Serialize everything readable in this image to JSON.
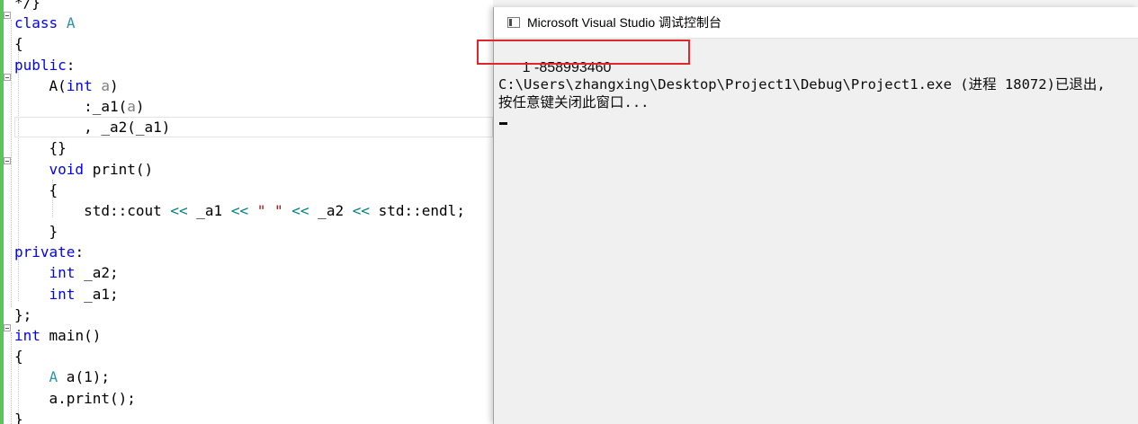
{
  "editor": {
    "lines": [
      "*/}",
      "class A",
      "{",
      "public:",
      "    A(int a)",
      "        :_a1(a)",
      "        , _a2(_a1)",
      "    {}",
      "    void print()",
      "    {",
      "        std::cout << _a1 << \" \" << _a2 << std::endl;",
      "    }",
      "private:",
      "    int _a2;",
      "    int _a1;",
      "};",
      "int main()",
      "{",
      "    A a(1);",
      "    a.print();",
      "}"
    ]
  },
  "console": {
    "title": "Microsoft Visual Studio 调试控制台",
    "output_line": "1 -858993460",
    "exit_line": "C:\\Users\\zhangxing\\Desktop\\Project1\\Debug\\Project1.exe (进程 18072)已退出,",
    "press_line": "按任意键关闭此窗口...",
    "icon": "console-app-icon"
  },
  "colors": {
    "keyword": "#0000ff",
    "type": "#2b91af",
    "parameter": "#808080",
    "string": "#a31515",
    "operator": "#008080",
    "highlight_box": "#e0262b",
    "change_bar": "#57c857"
  }
}
